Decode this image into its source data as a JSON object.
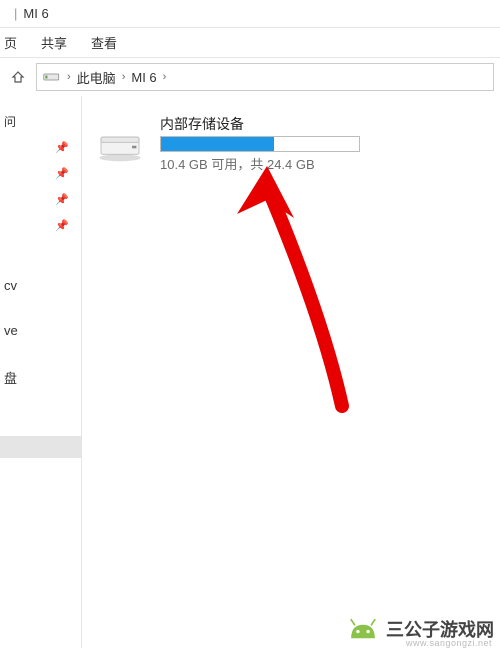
{
  "title": {
    "name": "MI 6"
  },
  "ribbon": {
    "tabs": [
      "页",
      "共享",
      "查看"
    ]
  },
  "breadcrumb": {
    "items": [
      "此电脑",
      "MI 6"
    ]
  },
  "nav": {
    "top": "问",
    "items": [
      "cv",
      "ve",
      "盘"
    ]
  },
  "storage": {
    "label": "内部存储设备",
    "free": "10.4 GB",
    "freeWord": "可用，共",
    "total": "24.4 GB",
    "usedPercent": 57
  },
  "watermark": {
    "text": "三公子游戏网",
    "url": "www.sangongzi.net"
  }
}
